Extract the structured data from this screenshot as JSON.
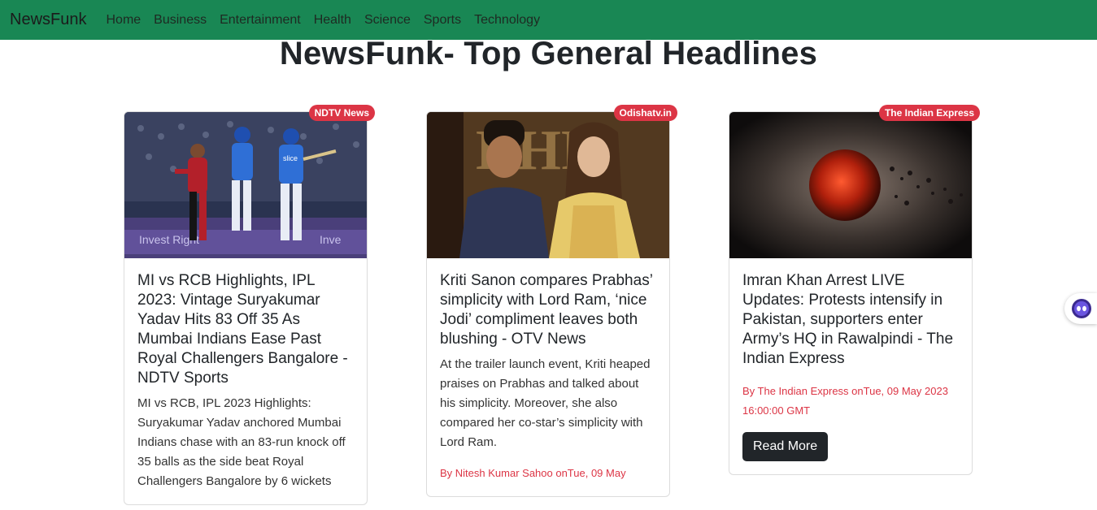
{
  "navbar": {
    "brand": "NewsFunk",
    "items": [
      {
        "label": "Home"
      },
      {
        "label": "Business"
      },
      {
        "label": "Entertainment"
      },
      {
        "label": "Health"
      },
      {
        "label": "Science"
      },
      {
        "label": "Sports"
      },
      {
        "label": "Technology"
      }
    ],
    "bg_color": "#198754"
  },
  "page": {
    "title": "NewsFunk- Top General Headlines"
  },
  "cards": [
    {
      "source": "NDTV News",
      "image_desc": "cricket-players-icon",
      "title": "MI vs RCB Highlights, IPL 2023: Vintage Suryakumar Yadav Hits 83 Off 35 As Mumbai Indians Ease Past Royal Challengers Bangalore - NDTV Sports",
      "description": "MI vs RCB, IPL 2023 Highlights: Suryakumar Yadav anchored Mumbai Indians chase with an 83-run knock off 35 balls as the side beat Royal Challengers Bangalore by 6 wickets"
    },
    {
      "source": "Odishatv.in",
      "title": "Kriti Sanon compares Prabhas’ simplicity with Lord Ram, ‘nice Jodi’ compliment leaves both blushing - OTV News",
      "description": "At the trailer launch event, Kriti heaped praises on Prabhas and talked about his simplicity. Moreover, she also compared her co-star’s simplicity with Lord Ram.",
      "meta": "By Nitesh Kumar Sahoo onTue, 09 May"
    },
    {
      "source": "The Indian Express",
      "title": "Imran Khan Arrest LIVE Updates: Protests intensify in Pakistan, supporters enter Army’s HQ in Rawalpindi - The Indian Express",
      "meta": "By The Indian Express onTue, 09 May 2023 16:00:00 GMT",
      "button": "Read More"
    }
  ],
  "colors": {
    "badge": "#dc3545",
    "button": "#212529",
    "meta": "#dc3545"
  }
}
